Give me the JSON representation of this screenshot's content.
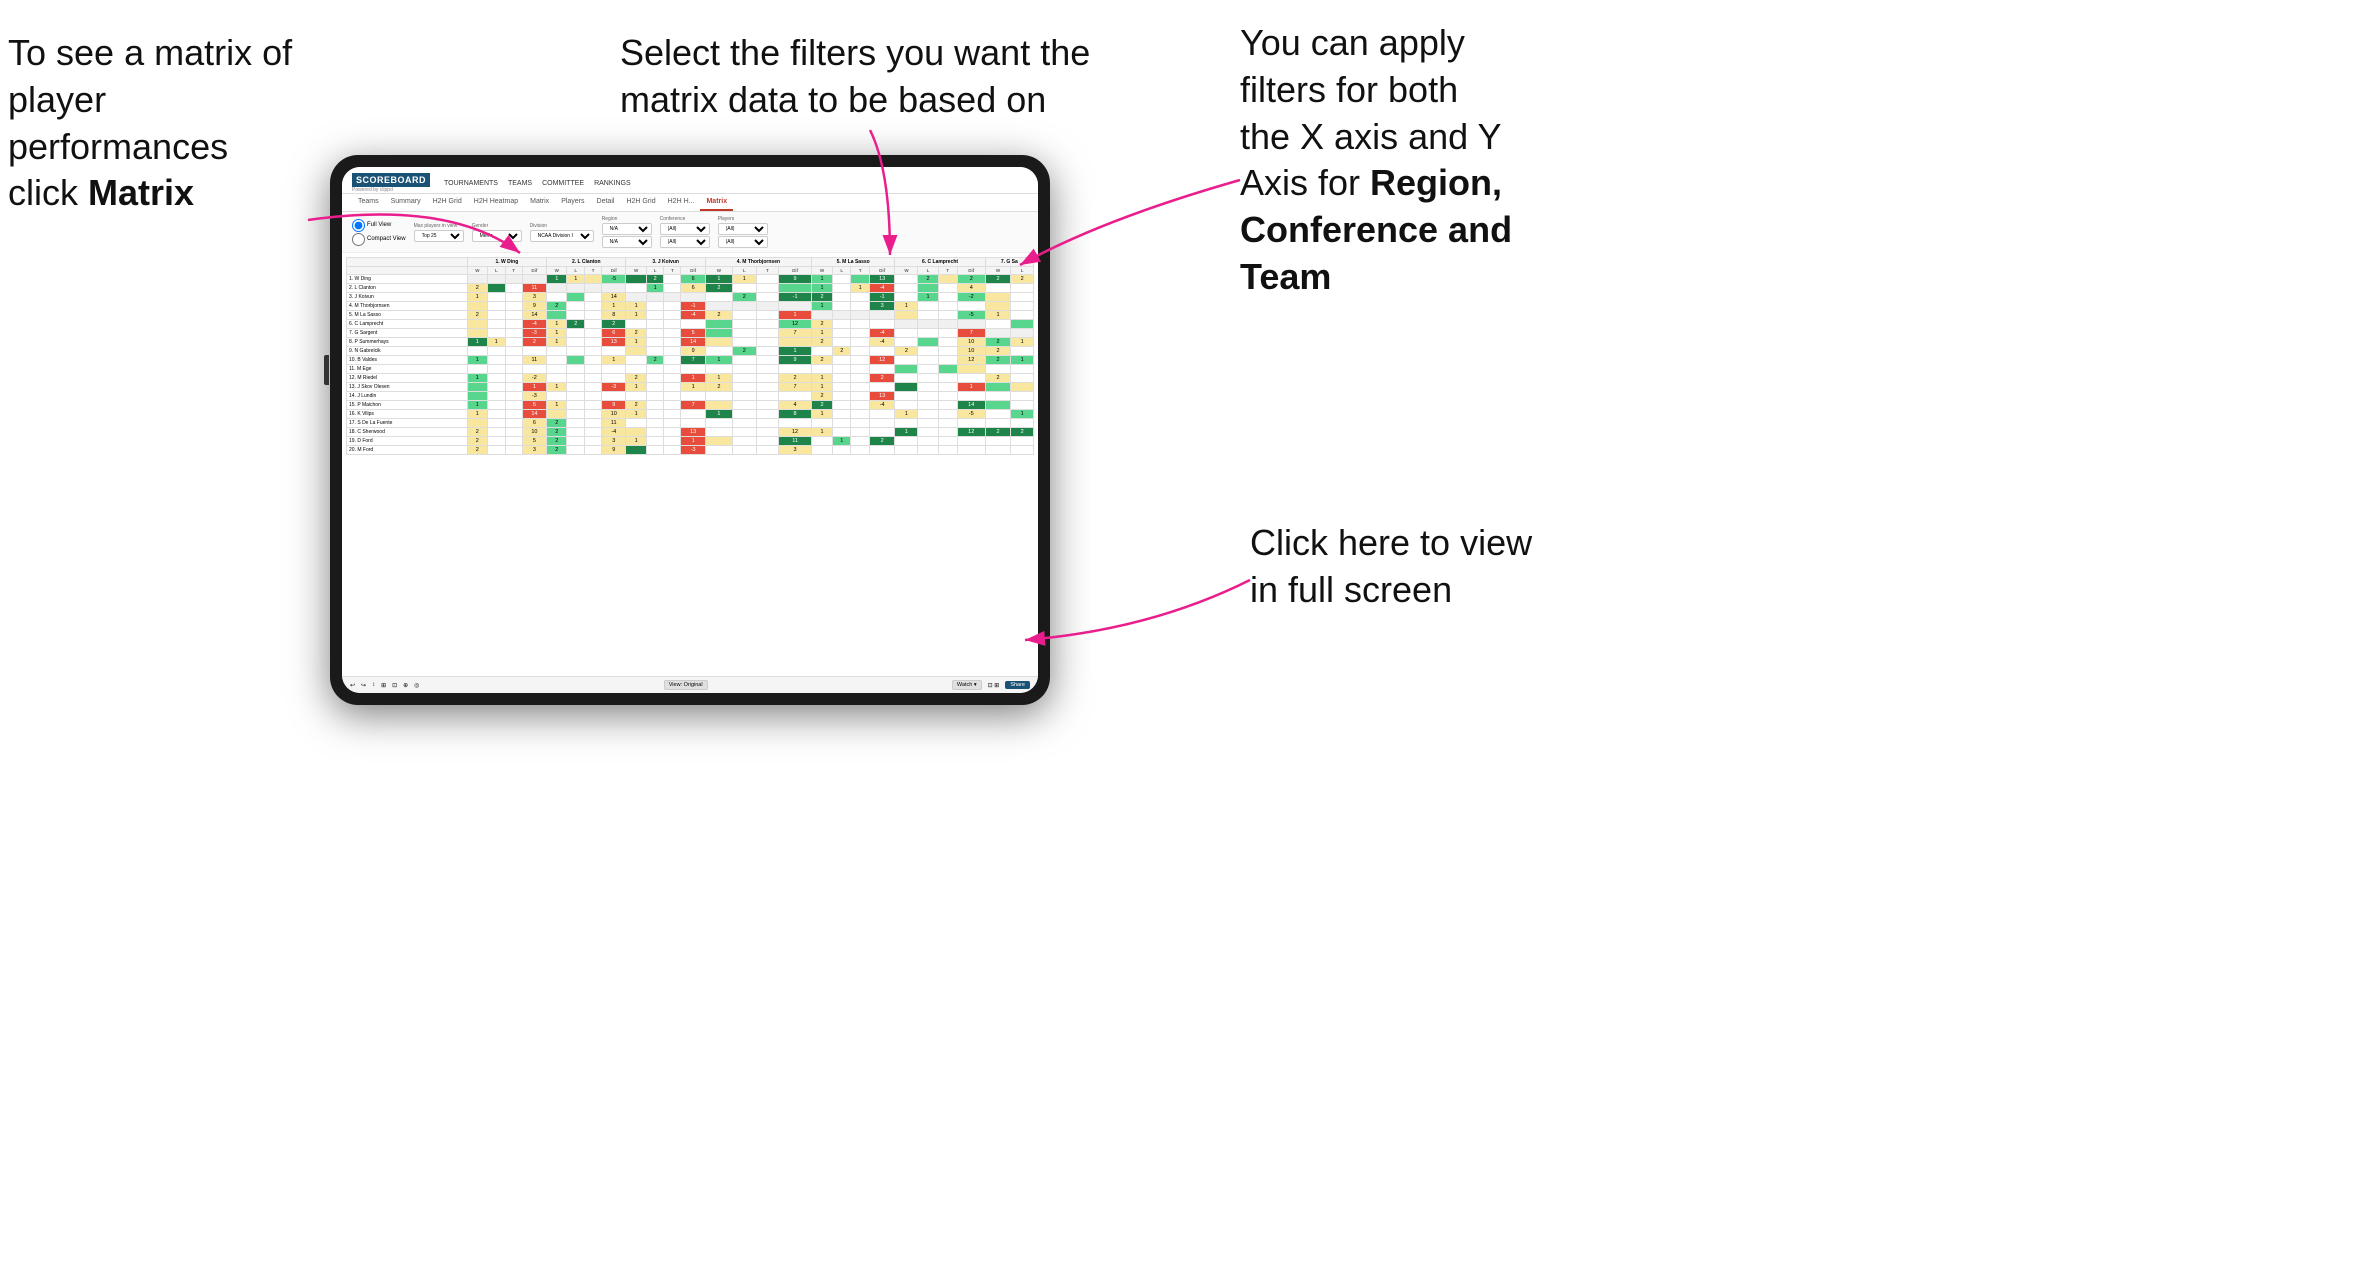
{
  "annotations": {
    "top_left": {
      "line1": "To see a matrix of",
      "line2": "player performances",
      "line3": "click ",
      "bold": "Matrix"
    },
    "top_center": {
      "line1": "Select the filters you want the",
      "line2": "matrix data to be based on"
    },
    "top_right": {
      "line1": "You  can apply",
      "line2": "filters for both",
      "line3": "the X axis and Y",
      "line4": "Axis for ",
      "bold1": "Region,",
      "line5": "",
      "bold2": "Conference and",
      "line6": "",
      "bold3": "Team"
    },
    "bottom_right": {
      "line1": "Click here to view",
      "line2": "in full screen"
    }
  },
  "nav": {
    "logo": "SCOREBOARD",
    "logo_sub": "Powered by clippd",
    "items": [
      "TOURNAMENTS",
      "TEAMS",
      "COMMITTEE",
      "RANKINGS"
    ]
  },
  "tabs": {
    "main_tabs": [
      "Teams",
      "Summary",
      "H2H Grid",
      "H2H Heatmap",
      "Matrix",
      "Players",
      "Summary",
      "Detail",
      "H2H Grid",
      "H2H H...",
      "Matrix"
    ],
    "active_tab": "Matrix"
  },
  "filters": {
    "view_options": [
      "Full View",
      "Compact View"
    ],
    "active_view": "Full View",
    "max_players_label": "Max players in view",
    "max_players_value": "Top 25",
    "gender_label": "Gender",
    "gender_value": "Men's",
    "division_label": "Division",
    "division_value": "NCAA Division I",
    "region_label": "Region",
    "region_values": [
      "N/A",
      "N/A"
    ],
    "conference_label": "Conference",
    "conference_values": [
      "(All)",
      "(All)"
    ],
    "players_label": "Players",
    "players_values": [
      "(All)",
      "(All)"
    ]
  },
  "matrix": {
    "col_headers": [
      "1. W Ding",
      "2. L Clanton",
      "3. J Koivun",
      "4. M Thorbjornsen",
      "5. M La Sasso",
      "6. C Lamprecht",
      "7. G Sa"
    ],
    "sub_headers": [
      "W",
      "L",
      "T",
      "Dif"
    ],
    "rows": [
      {
        "name": "1. W Ding",
        "cells": [
          "c-grey",
          "c-grey",
          "c-grey",
          "c-grey",
          "c-green-dark",
          "c-yellow",
          "c-yellow",
          "c-green-mid",
          "c-green-dark",
          "c-green-dark",
          "c-white",
          "c-green-mid",
          "c-green-dark",
          "c-yellow",
          "c-white",
          "c-green-dark",
          "c-green-mid",
          "c-white",
          "c-green-mid",
          "c-green-dark",
          "c-white",
          "c-green-mid",
          "c-yellow",
          "c-green-mid",
          "c-green-dark",
          "c-yellow"
        ]
      },
      {
        "name": "2. L Clanton",
        "cells": [
          "c-yellow",
          "c-green-dark",
          "c-white",
          "c-red",
          "c-grey",
          "c-grey",
          "c-grey",
          "c-grey",
          "c-white",
          "c-green-mid",
          "c-white",
          "c-yellow",
          "c-green-dark",
          "c-white",
          "c-white",
          "c-green-mid",
          "c-green-mid",
          "c-white",
          "c-yellow",
          "c-red",
          "c-white",
          "c-green-mid",
          "c-white",
          "c-yellow",
          "c-white",
          "c-white"
        ]
      },
      {
        "name": "3. J Koivun",
        "cells": [
          "c-yellow",
          "c-white",
          "c-white",
          "c-yellow",
          "c-white",
          "c-green-mid",
          "c-white",
          "c-yellow",
          "c-grey",
          "c-grey",
          "c-grey",
          "c-grey",
          "c-white",
          "c-green-mid",
          "c-white",
          "c-green-dark",
          "c-green-dark",
          "c-white",
          "c-white",
          "c-green-dark",
          "c-white",
          "c-green-mid",
          "c-white",
          "c-green-mid",
          "c-yellow",
          "c-white"
        ]
      },
      {
        "name": "4. M Thorbjornsen",
        "cells": [
          "c-yellow",
          "c-white",
          "c-white",
          "c-yellow",
          "c-green-mid",
          "c-white",
          "c-white",
          "c-yellow",
          "c-yellow",
          "c-white",
          "c-white",
          "c-red",
          "c-grey",
          "c-grey",
          "c-grey",
          "c-grey",
          "c-green-mid",
          "c-white",
          "c-white",
          "c-green-dark",
          "c-yellow",
          "c-white",
          "c-white",
          "c-white",
          "c-yellow",
          "c-white"
        ]
      },
      {
        "name": "5. M La Sasso",
        "cells": [
          "c-yellow",
          "c-white",
          "c-white",
          "c-yellow",
          "c-green-mid",
          "c-white",
          "c-white",
          "c-yellow",
          "c-yellow",
          "c-white",
          "c-white",
          "c-red",
          "c-yellow",
          "c-white",
          "c-white",
          "c-red",
          "c-grey",
          "c-grey",
          "c-grey",
          "c-grey",
          "c-yellow",
          "c-white",
          "c-white",
          "c-green-mid",
          "c-yellow",
          "c-white"
        ]
      },
      {
        "name": "6. C Lamprecht",
        "cells": [
          "c-yellow",
          "c-white",
          "c-white",
          "c-red",
          "c-yellow",
          "c-green-dark",
          "c-white",
          "c-green-dark",
          "c-white",
          "c-white",
          "c-white",
          "c-white",
          "c-green-mid",
          "c-white",
          "c-white",
          "c-green-mid",
          "c-yellow",
          "c-white",
          "c-white",
          "c-white",
          "c-grey",
          "c-grey",
          "c-grey",
          "c-grey",
          "c-white",
          "c-green-mid"
        ]
      },
      {
        "name": "7. G Sargent",
        "cells": [
          "c-yellow",
          "c-white",
          "c-white",
          "c-red",
          "c-yellow",
          "c-white",
          "c-white",
          "c-red",
          "c-yellow",
          "c-white",
          "c-white",
          "c-red",
          "c-green-mid",
          "c-white",
          "c-white",
          "c-yellow",
          "c-yellow",
          "c-white",
          "c-white",
          "c-red",
          "c-white",
          "c-white",
          "c-white",
          "c-red",
          "c-grey",
          "c-grey"
        ]
      },
      {
        "name": "8. P Summerhays",
        "cells": [
          "c-green-dark",
          "c-yellow",
          "c-white",
          "c-red",
          "c-yellow",
          "c-white",
          "c-white",
          "c-red",
          "c-yellow",
          "c-white",
          "c-white",
          "c-red",
          "c-yellow",
          "c-white",
          "c-white",
          "c-yellow",
          "c-yellow",
          "c-white",
          "c-white",
          "c-yellow",
          "c-white",
          "c-green-mid",
          "c-white",
          "c-yellow",
          "c-green-mid",
          "c-yellow"
        ]
      },
      {
        "name": "9. N Gabrelcik",
        "cells": [
          "c-white",
          "c-white",
          "c-white",
          "c-white",
          "c-white",
          "c-white",
          "c-white",
          "c-white",
          "c-yellow",
          "c-white",
          "c-white",
          "c-yellow",
          "c-white",
          "c-green-mid",
          "c-white",
          "c-green-dark",
          "c-white",
          "c-yellow",
          "c-white",
          "c-white",
          "c-yellow",
          "c-white",
          "c-white",
          "c-yellow",
          "c-yellow",
          "c-white"
        ]
      },
      {
        "name": "10. B Valdes",
        "cells": [
          "c-green-mid",
          "c-white",
          "c-white",
          "c-yellow",
          "c-white",
          "c-green-mid",
          "c-white",
          "c-yellow",
          "c-white",
          "c-green-mid",
          "c-white",
          "c-green-dark",
          "c-green-mid",
          "c-white",
          "c-white",
          "c-green-dark",
          "c-yellow",
          "c-white",
          "c-white",
          "c-red",
          "c-white",
          "c-white",
          "c-white",
          "c-yellow",
          "c-green-mid",
          "c-green-mid"
        ]
      },
      {
        "name": "11. M Ege",
        "cells": [
          "c-white",
          "c-white",
          "c-white",
          "c-white",
          "c-white",
          "c-white",
          "c-white",
          "c-white",
          "c-white",
          "c-white",
          "c-white",
          "c-white",
          "c-white",
          "c-white",
          "c-white",
          "c-white",
          "c-white",
          "c-white",
          "c-white",
          "c-white",
          "c-green-mid",
          "c-white",
          "c-green-mid",
          "c-yellow",
          "c-white",
          "c-white"
        ]
      },
      {
        "name": "12. M Riedel",
        "cells": [
          "c-green-mid",
          "c-white",
          "c-white",
          "c-yellow",
          "c-white",
          "c-white",
          "c-white",
          "c-white",
          "c-yellow",
          "c-white",
          "c-white",
          "c-red",
          "c-yellow",
          "c-white",
          "c-white",
          "c-yellow",
          "c-yellow",
          "c-white",
          "c-white",
          "c-red",
          "c-white",
          "c-white",
          "c-white",
          "c-white",
          "c-yellow",
          "c-white"
        ]
      },
      {
        "name": "13. J Skov Olesen",
        "cells": [
          "c-green-mid",
          "c-white",
          "c-white",
          "c-red",
          "c-yellow",
          "c-white",
          "c-white",
          "c-red",
          "c-yellow",
          "c-white",
          "c-white",
          "c-yellow",
          "c-yellow",
          "c-white",
          "c-white",
          "c-yellow",
          "c-yellow",
          "c-white",
          "c-white",
          "c-white",
          "c-green-dark",
          "c-white",
          "c-white",
          "c-red",
          "c-green-mid",
          "c-yellow"
        ]
      },
      {
        "name": "14. J Lundin",
        "cells": [
          "c-green-mid",
          "c-white",
          "c-white",
          "c-yellow",
          "c-white",
          "c-white",
          "c-white",
          "c-white",
          "c-white",
          "c-white",
          "c-white",
          "c-white",
          "c-white",
          "c-white",
          "c-white",
          "c-white",
          "c-yellow",
          "c-white",
          "c-white",
          "c-red",
          "c-white",
          "c-white",
          "c-white",
          "c-white",
          "c-white",
          "c-white"
        ]
      },
      {
        "name": "15. P Maichon",
        "cells": [
          "c-green-mid",
          "c-white",
          "c-white",
          "c-red",
          "c-yellow",
          "c-white",
          "c-white",
          "c-red",
          "c-yellow",
          "c-white",
          "c-white",
          "c-red",
          "c-yellow",
          "c-white",
          "c-white",
          "c-yellow",
          "c-green-dark",
          "c-white",
          "c-white",
          "c-yellow",
          "c-white",
          "c-white",
          "c-white",
          "c-green-dark",
          "c-green-mid",
          "c-white"
        ]
      },
      {
        "name": "16. K Vilips",
        "cells": [
          "c-yellow",
          "c-white",
          "c-white",
          "c-red",
          "c-yellow",
          "c-white",
          "c-white",
          "c-yellow",
          "c-yellow",
          "c-white",
          "c-white",
          "c-white",
          "c-green-dark",
          "c-white",
          "c-white",
          "c-green-dark",
          "c-yellow",
          "c-white",
          "c-white",
          "c-white",
          "c-yellow",
          "c-white",
          "c-white",
          "c-yellow",
          "c-white",
          "c-green-mid"
        ]
      },
      {
        "name": "17. S De La Fuente",
        "cells": [
          "c-yellow",
          "c-white",
          "c-white",
          "c-yellow",
          "c-green-mid",
          "c-white",
          "c-white",
          "c-yellow",
          "c-white",
          "c-white",
          "c-white",
          "c-white",
          "c-white",
          "c-white",
          "c-white",
          "c-white",
          "c-white",
          "c-white",
          "c-white",
          "c-white",
          "c-white",
          "c-white",
          "c-white",
          "c-white",
          "c-white",
          "c-white"
        ]
      },
      {
        "name": "18. C Sherwood",
        "cells": [
          "c-yellow",
          "c-white",
          "c-white",
          "c-yellow",
          "c-green-mid",
          "c-white",
          "c-white",
          "c-yellow",
          "c-yellow",
          "c-white",
          "c-white",
          "c-red",
          "c-white",
          "c-white",
          "c-white",
          "c-yellow",
          "c-yellow",
          "c-white",
          "c-white",
          "c-white",
          "c-green-dark",
          "c-white",
          "c-white",
          "c-green-dark",
          "c-green-dark",
          "c-green-dark"
        ]
      },
      {
        "name": "19. D Ford",
        "cells": [
          "c-yellow",
          "c-white",
          "c-white",
          "c-yellow",
          "c-green-mid",
          "c-white",
          "c-white",
          "c-yellow",
          "c-yellow",
          "c-white",
          "c-white",
          "c-red",
          "c-yellow",
          "c-white",
          "c-white",
          "c-green-dark",
          "c-white",
          "c-green-mid",
          "c-white",
          "c-green-dark",
          "c-white",
          "c-white",
          "c-white",
          "c-white",
          "c-white",
          "c-white"
        ]
      },
      {
        "name": "20. M Ford",
        "cells": [
          "c-yellow",
          "c-white",
          "c-white",
          "c-yellow",
          "c-green-mid",
          "c-white",
          "c-white",
          "c-yellow",
          "c-green-dark",
          "c-white",
          "c-white",
          "c-red",
          "c-white",
          "c-white",
          "c-white",
          "c-yellow",
          "c-white",
          "c-white",
          "c-white",
          "c-white",
          "c-white",
          "c-white",
          "c-white",
          "c-white",
          "c-white",
          "c-white"
        ]
      }
    ]
  },
  "toolbar": {
    "left_items": [
      "↩",
      "↪",
      "↕",
      "⊞",
      "⊡",
      "⊕",
      "◎"
    ],
    "view_label": "View: Original",
    "watch_label": "Watch ▾",
    "share_label": "Share"
  }
}
